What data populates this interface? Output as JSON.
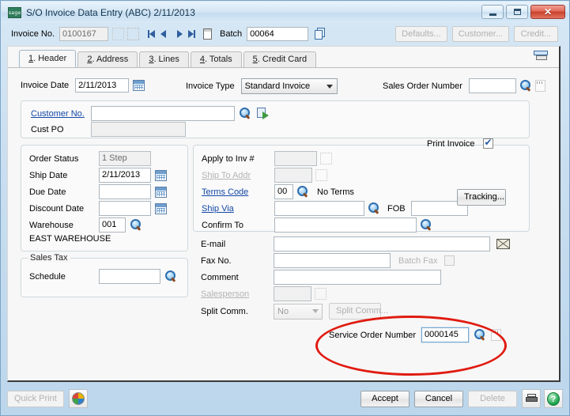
{
  "window": {
    "title": "S/O Invoice Data Entry (ABC) 2/11/2013",
    "logo_text": "sage",
    "minimize_label": "Minimize",
    "maximize_label": "Maximize",
    "close_label": "Close"
  },
  "toolbar": {
    "invoice_no_label": "Invoice No.",
    "invoice_no_value": "0100167",
    "batch_label": "Batch",
    "batch_value": "00064",
    "defaults_label": "Defaults...",
    "customer_label": "Customer...",
    "credit_label": "Credit..."
  },
  "tabs": [
    {
      "num": "1",
      "label": ". Header",
      "active": true
    },
    {
      "num": "2",
      "label": ". Address",
      "active": false
    },
    {
      "num": "3",
      "label": ". Lines",
      "active": false
    },
    {
      "num": "4",
      "label": ". Totals",
      "active": false
    },
    {
      "num": "5",
      "label": ". Credit Card",
      "active": false
    }
  ],
  "header": {
    "invoice_date_label": "Invoice Date",
    "invoice_date_value": "2/11/2013",
    "invoice_type_label": "Invoice Type",
    "invoice_type_value": "Standard Invoice",
    "sales_order_number_label": "Sales Order Number",
    "sales_order_number_value": "",
    "customer_no_label": "Customer No.",
    "customer_no_value": "",
    "cust_po_label": "Cust PO",
    "cust_po_value": ""
  },
  "left_panel": {
    "order_status_label": "Order Status",
    "order_status_value": "1 Step",
    "ship_date_label": "Ship Date",
    "ship_date_value": "2/11/2013",
    "due_date_label": "Due Date",
    "due_date_value": "",
    "discount_date_label": "Discount Date",
    "discount_date_value": "",
    "warehouse_label": "Warehouse",
    "warehouse_value": "001",
    "warehouse_desc": "EAST WAREHOUSE",
    "sales_tax_group": "Sales Tax",
    "schedule_label": "Schedule",
    "schedule_value": ""
  },
  "right_panel": {
    "apply_to_inv_label": "Apply to Inv #",
    "apply_to_inv_value": "",
    "ship_to_addr_label": "Ship To Addr",
    "ship_to_addr_value": "",
    "terms_code_label": "Terms Code",
    "terms_code_value": "00",
    "terms_code_desc": "No Terms",
    "ship_via_label": "Ship Via",
    "ship_via_value": "",
    "fob_label": "FOB",
    "fob_value": "",
    "tracking_label": "Tracking...",
    "confirm_to_label": "Confirm To",
    "confirm_to_value": "",
    "email_label": "E-mail",
    "email_value": "",
    "fax_no_label": "Fax No.",
    "fax_no_value": "",
    "batch_fax_label": "Batch Fax",
    "comment_label": "Comment",
    "comment_value": "",
    "salesperson_label": "Salesperson",
    "salesperson_value": "",
    "split_comm_label": "Split Comm.",
    "split_comm_value": "No",
    "split_comm_button_label": "Split Comm...",
    "print_invoice_label": "Print Invoice"
  },
  "service_order": {
    "label": "Service Order Number",
    "value": "0000145"
  },
  "footer": {
    "quick_print_label": "Quick Print",
    "accept_label": "Accept",
    "cancel_label": "Cancel",
    "delete_label": "Delete"
  },
  "colors": {
    "annotation": "#e01b10",
    "link": "#1348a6",
    "accent": "#2f6fae",
    "brand_green": "#2e7d5b"
  }
}
